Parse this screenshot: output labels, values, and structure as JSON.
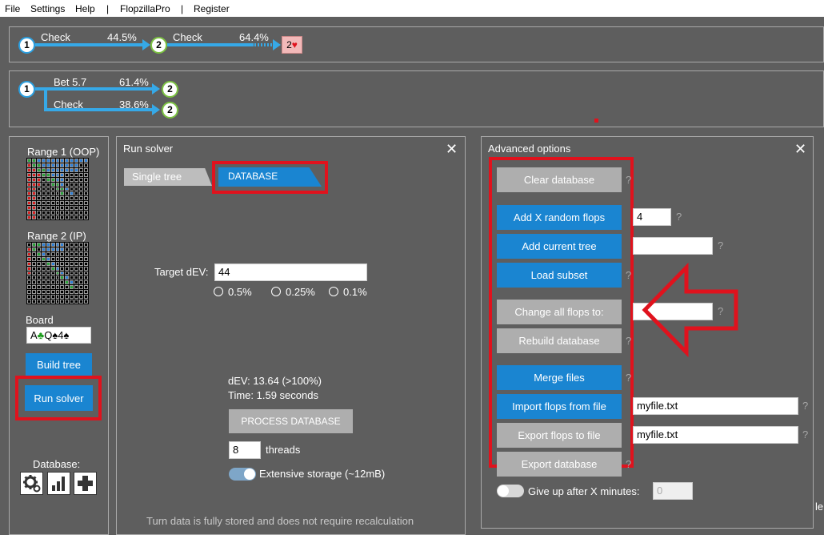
{
  "menu": {
    "file": "File",
    "settings": "Settings",
    "help": "Help",
    "sep1": "|",
    "app": "FlopzillaPro",
    "sep2": "|",
    "register": "Register"
  },
  "tree1": {
    "node1": "1",
    "action1": "Check",
    "pct1": "44.5%",
    "node2": "2",
    "action2": "Check",
    "pct2": "64.4%",
    "card_rank": "2",
    "card_suit": "♥"
  },
  "tree2": {
    "node1": "1",
    "action1": "Bet 5.7",
    "pct1": "61.4%",
    "node2a": "2",
    "action2": "Check",
    "pct2": "38.6%",
    "node2b": "2"
  },
  "left": {
    "range1_label": "Range 1 (OOP)",
    "range2_label": "Range 2 (IP)",
    "board_label": "Board",
    "board_cards": [
      {
        "rank": "A",
        "suit": "♣",
        "color": "#1a9b1a"
      },
      {
        "rank": "Q",
        "suit": "♠",
        "color": "#000000"
      },
      {
        "rank": "4",
        "suit": "♠",
        "color": "#000000"
      }
    ],
    "build_tree": "Build tree",
    "run_solver": "Run solver",
    "database_label": "Database:",
    "icons": [
      "gear-icon",
      "bar-chart-icon",
      "plus-icon"
    ]
  },
  "run_solver": {
    "title": "Run solver",
    "close": "✕",
    "tab_single": "Single tree",
    "tab_database": "DATABASE",
    "target_label": "Target dEV:",
    "target_value": "44",
    "radio_options": [
      "0.5%",
      "0.25%",
      "0.1%"
    ],
    "dev_line": "dEV: 13.64 (>100%)",
    "time_line": "Time: 1.59 seconds",
    "process_button": "PROCESS DATABASE",
    "threads_value": "8",
    "threads_label": "threads",
    "extensive_label": "Extensive storage (~12mB)",
    "footer": "Turn data is fully stored and does not require recalculation"
  },
  "advanced": {
    "title": "Advanced options",
    "close": "✕",
    "clear_db": "Clear database",
    "add_random": "Add X random flops",
    "random_count": "4",
    "add_current": "Add current tree",
    "load_subset": "Load subset",
    "change_all": "Change all flops to:",
    "rebuild": "Rebuild database",
    "merge": "Merge files",
    "import": "Import flops from file",
    "import_file": "myfile.txt",
    "export_flops": "Export flops to file",
    "export_file": "myfile.txt",
    "export_db": "Export database",
    "give_up": "Give up after X minutes:",
    "give_up_value": "0",
    "qmark": "?",
    "edge_text": "le"
  },
  "colors": {
    "accent_blue": "#1a85d1",
    "highlight_red": "#e0121d",
    "panel_bg": "#5e5e5e",
    "button_gray": "#aeaeae"
  }
}
